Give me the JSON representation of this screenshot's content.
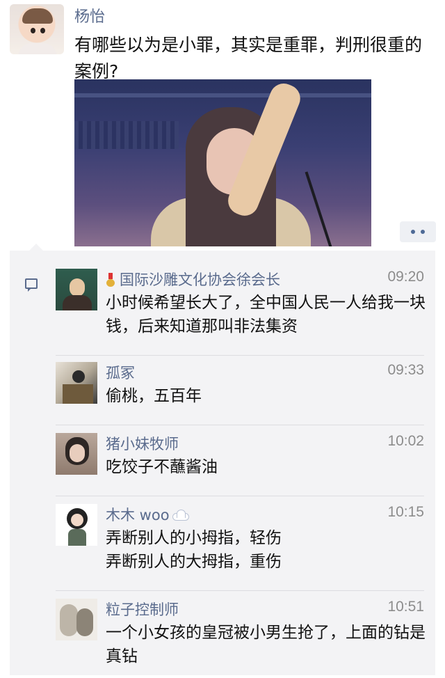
{
  "post": {
    "author": "杨怡",
    "text": "有哪些以为是小罪，其实是重罪，判刑很重的案例?"
  },
  "comments": [
    {
      "name": "国际沙雕文化协会徐会长",
      "time": "09:20",
      "text": "小时候希望长大了，全中国人民一人给我一块钱，后来知道那叫非法集资",
      "badge": "medal-icon"
    },
    {
      "name": "孤冢",
      "time": "09:33",
      "text": "偷桃，五百年"
    },
    {
      "name": "猪小妹牧师",
      "time": "10:02",
      "text": "吃饺子不蘸酱油"
    },
    {
      "name": "木木 woo",
      "time": "10:15",
      "text": "弄断别人的小拇指，轻伤\n弄断别人的大拇指，重伤",
      "badge": "cloud-icon"
    },
    {
      "name": "粒子控制师",
      "time": "10:51",
      "text": "一个小女孩的皇冠被小男生抢了，上面的钻是真钻"
    }
  ],
  "colors": {
    "name": "#5a6b8d",
    "time": "#8c8c8c",
    "comment_bg": "#f3f3f5"
  }
}
